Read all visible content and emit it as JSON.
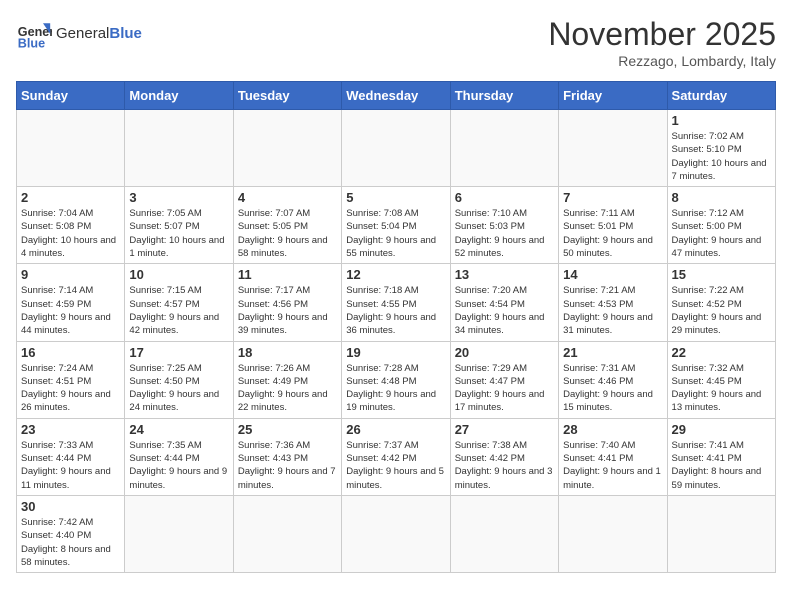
{
  "header": {
    "logo_general": "General",
    "logo_blue": "Blue",
    "month_title": "November 2025",
    "location": "Rezzago, Lombardy, Italy"
  },
  "weekdays": [
    "Sunday",
    "Monday",
    "Tuesday",
    "Wednesday",
    "Thursday",
    "Friday",
    "Saturday"
  ],
  "weeks": [
    [
      {
        "day": "",
        "info": ""
      },
      {
        "day": "",
        "info": ""
      },
      {
        "day": "",
        "info": ""
      },
      {
        "day": "",
        "info": ""
      },
      {
        "day": "",
        "info": ""
      },
      {
        "day": "",
        "info": ""
      },
      {
        "day": "1",
        "info": "Sunrise: 7:02 AM\nSunset: 5:10 PM\nDaylight: 10 hours and 7 minutes."
      }
    ],
    [
      {
        "day": "2",
        "info": "Sunrise: 7:04 AM\nSunset: 5:08 PM\nDaylight: 10 hours and 4 minutes."
      },
      {
        "day": "3",
        "info": "Sunrise: 7:05 AM\nSunset: 5:07 PM\nDaylight: 10 hours and 1 minute."
      },
      {
        "day": "4",
        "info": "Sunrise: 7:07 AM\nSunset: 5:05 PM\nDaylight: 9 hours and 58 minutes."
      },
      {
        "day": "5",
        "info": "Sunrise: 7:08 AM\nSunset: 5:04 PM\nDaylight: 9 hours and 55 minutes."
      },
      {
        "day": "6",
        "info": "Sunrise: 7:10 AM\nSunset: 5:03 PM\nDaylight: 9 hours and 52 minutes."
      },
      {
        "day": "7",
        "info": "Sunrise: 7:11 AM\nSunset: 5:01 PM\nDaylight: 9 hours and 50 minutes."
      },
      {
        "day": "8",
        "info": "Sunrise: 7:12 AM\nSunset: 5:00 PM\nDaylight: 9 hours and 47 minutes."
      }
    ],
    [
      {
        "day": "9",
        "info": "Sunrise: 7:14 AM\nSunset: 4:59 PM\nDaylight: 9 hours and 44 minutes."
      },
      {
        "day": "10",
        "info": "Sunrise: 7:15 AM\nSunset: 4:57 PM\nDaylight: 9 hours and 42 minutes."
      },
      {
        "day": "11",
        "info": "Sunrise: 7:17 AM\nSunset: 4:56 PM\nDaylight: 9 hours and 39 minutes."
      },
      {
        "day": "12",
        "info": "Sunrise: 7:18 AM\nSunset: 4:55 PM\nDaylight: 9 hours and 36 minutes."
      },
      {
        "day": "13",
        "info": "Sunrise: 7:20 AM\nSunset: 4:54 PM\nDaylight: 9 hours and 34 minutes."
      },
      {
        "day": "14",
        "info": "Sunrise: 7:21 AM\nSunset: 4:53 PM\nDaylight: 9 hours and 31 minutes."
      },
      {
        "day": "15",
        "info": "Sunrise: 7:22 AM\nSunset: 4:52 PM\nDaylight: 9 hours and 29 minutes."
      }
    ],
    [
      {
        "day": "16",
        "info": "Sunrise: 7:24 AM\nSunset: 4:51 PM\nDaylight: 9 hours and 26 minutes."
      },
      {
        "day": "17",
        "info": "Sunrise: 7:25 AM\nSunset: 4:50 PM\nDaylight: 9 hours and 24 minutes."
      },
      {
        "day": "18",
        "info": "Sunrise: 7:26 AM\nSunset: 4:49 PM\nDaylight: 9 hours and 22 minutes."
      },
      {
        "day": "19",
        "info": "Sunrise: 7:28 AM\nSunset: 4:48 PM\nDaylight: 9 hours and 19 minutes."
      },
      {
        "day": "20",
        "info": "Sunrise: 7:29 AM\nSunset: 4:47 PM\nDaylight: 9 hours and 17 minutes."
      },
      {
        "day": "21",
        "info": "Sunrise: 7:31 AM\nSunset: 4:46 PM\nDaylight: 9 hours and 15 minutes."
      },
      {
        "day": "22",
        "info": "Sunrise: 7:32 AM\nSunset: 4:45 PM\nDaylight: 9 hours and 13 minutes."
      }
    ],
    [
      {
        "day": "23",
        "info": "Sunrise: 7:33 AM\nSunset: 4:44 PM\nDaylight: 9 hours and 11 minutes."
      },
      {
        "day": "24",
        "info": "Sunrise: 7:35 AM\nSunset: 4:44 PM\nDaylight: 9 hours and 9 minutes."
      },
      {
        "day": "25",
        "info": "Sunrise: 7:36 AM\nSunset: 4:43 PM\nDaylight: 9 hours and 7 minutes."
      },
      {
        "day": "26",
        "info": "Sunrise: 7:37 AM\nSunset: 4:42 PM\nDaylight: 9 hours and 5 minutes."
      },
      {
        "day": "27",
        "info": "Sunrise: 7:38 AM\nSunset: 4:42 PM\nDaylight: 9 hours and 3 minutes."
      },
      {
        "day": "28",
        "info": "Sunrise: 7:40 AM\nSunset: 4:41 PM\nDaylight: 9 hours and 1 minute."
      },
      {
        "day": "29",
        "info": "Sunrise: 7:41 AM\nSunset: 4:41 PM\nDaylight: 8 hours and 59 minutes."
      }
    ],
    [
      {
        "day": "30",
        "info": "Sunrise: 7:42 AM\nSunset: 4:40 PM\nDaylight: 8 hours and 58 minutes."
      },
      {
        "day": "",
        "info": ""
      },
      {
        "day": "",
        "info": ""
      },
      {
        "day": "",
        "info": ""
      },
      {
        "day": "",
        "info": ""
      },
      {
        "day": "",
        "info": ""
      },
      {
        "day": "",
        "info": ""
      }
    ]
  ]
}
